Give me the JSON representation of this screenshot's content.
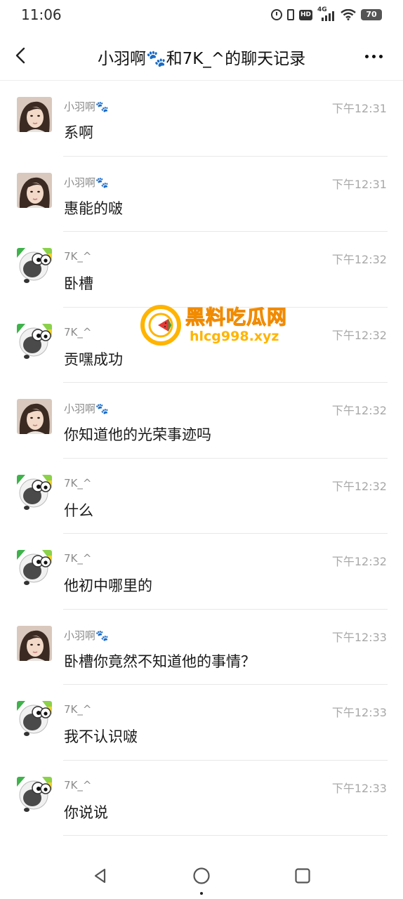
{
  "status_bar": {
    "time": "11:06",
    "network": "4G",
    "hd": "HD",
    "battery": "70"
  },
  "header": {
    "title": "小羽啊🐾和7K_^的聊天记录"
  },
  "messages": [
    {
      "sender": "小羽啊🐾",
      "avatar": "girl",
      "time": "下午12:31",
      "text": "系啊"
    },
    {
      "sender": "小羽啊🐾",
      "avatar": "girl",
      "time": "下午12:31",
      "text": "惠能的啵"
    },
    {
      "sender": "7K_^",
      "avatar": "sheep",
      "time": "下午12:32",
      "text": "卧槽"
    },
    {
      "sender": "7K_^",
      "avatar": "sheep",
      "time": "下午12:32",
      "text": "贡嘿成功"
    },
    {
      "sender": "小羽啊🐾",
      "avatar": "girl",
      "time": "下午12:32",
      "text": "你知道他的光荣事迹吗"
    },
    {
      "sender": "7K_^",
      "avatar": "sheep",
      "time": "下午12:32",
      "text": "什么"
    },
    {
      "sender": "7K_^",
      "avatar": "sheep",
      "time": "下午12:32",
      "text": "他初中哪里的"
    },
    {
      "sender": "小羽啊🐾",
      "avatar": "girl",
      "time": "下午12:33",
      "text": "卧槽你竟然不知道他的事情？"
    },
    {
      "sender": "7K_^",
      "avatar": "sheep",
      "time": "下午12:33",
      "text": "我不认识啵"
    },
    {
      "sender": "7K_^",
      "avatar": "sheep",
      "time": "下午12:33",
      "text": "你说说"
    }
  ],
  "watermark": {
    "name": "黑料吃瓜网",
    "url": "hlcg998.xyz",
    "color": "#ffb400"
  },
  "icons": {
    "back": "chevron-left-icon",
    "more": "more-dots-icon",
    "nav_back": "triangle-back-icon",
    "nav_home": "circle-home-icon",
    "nav_recent": "square-recent-icon"
  }
}
